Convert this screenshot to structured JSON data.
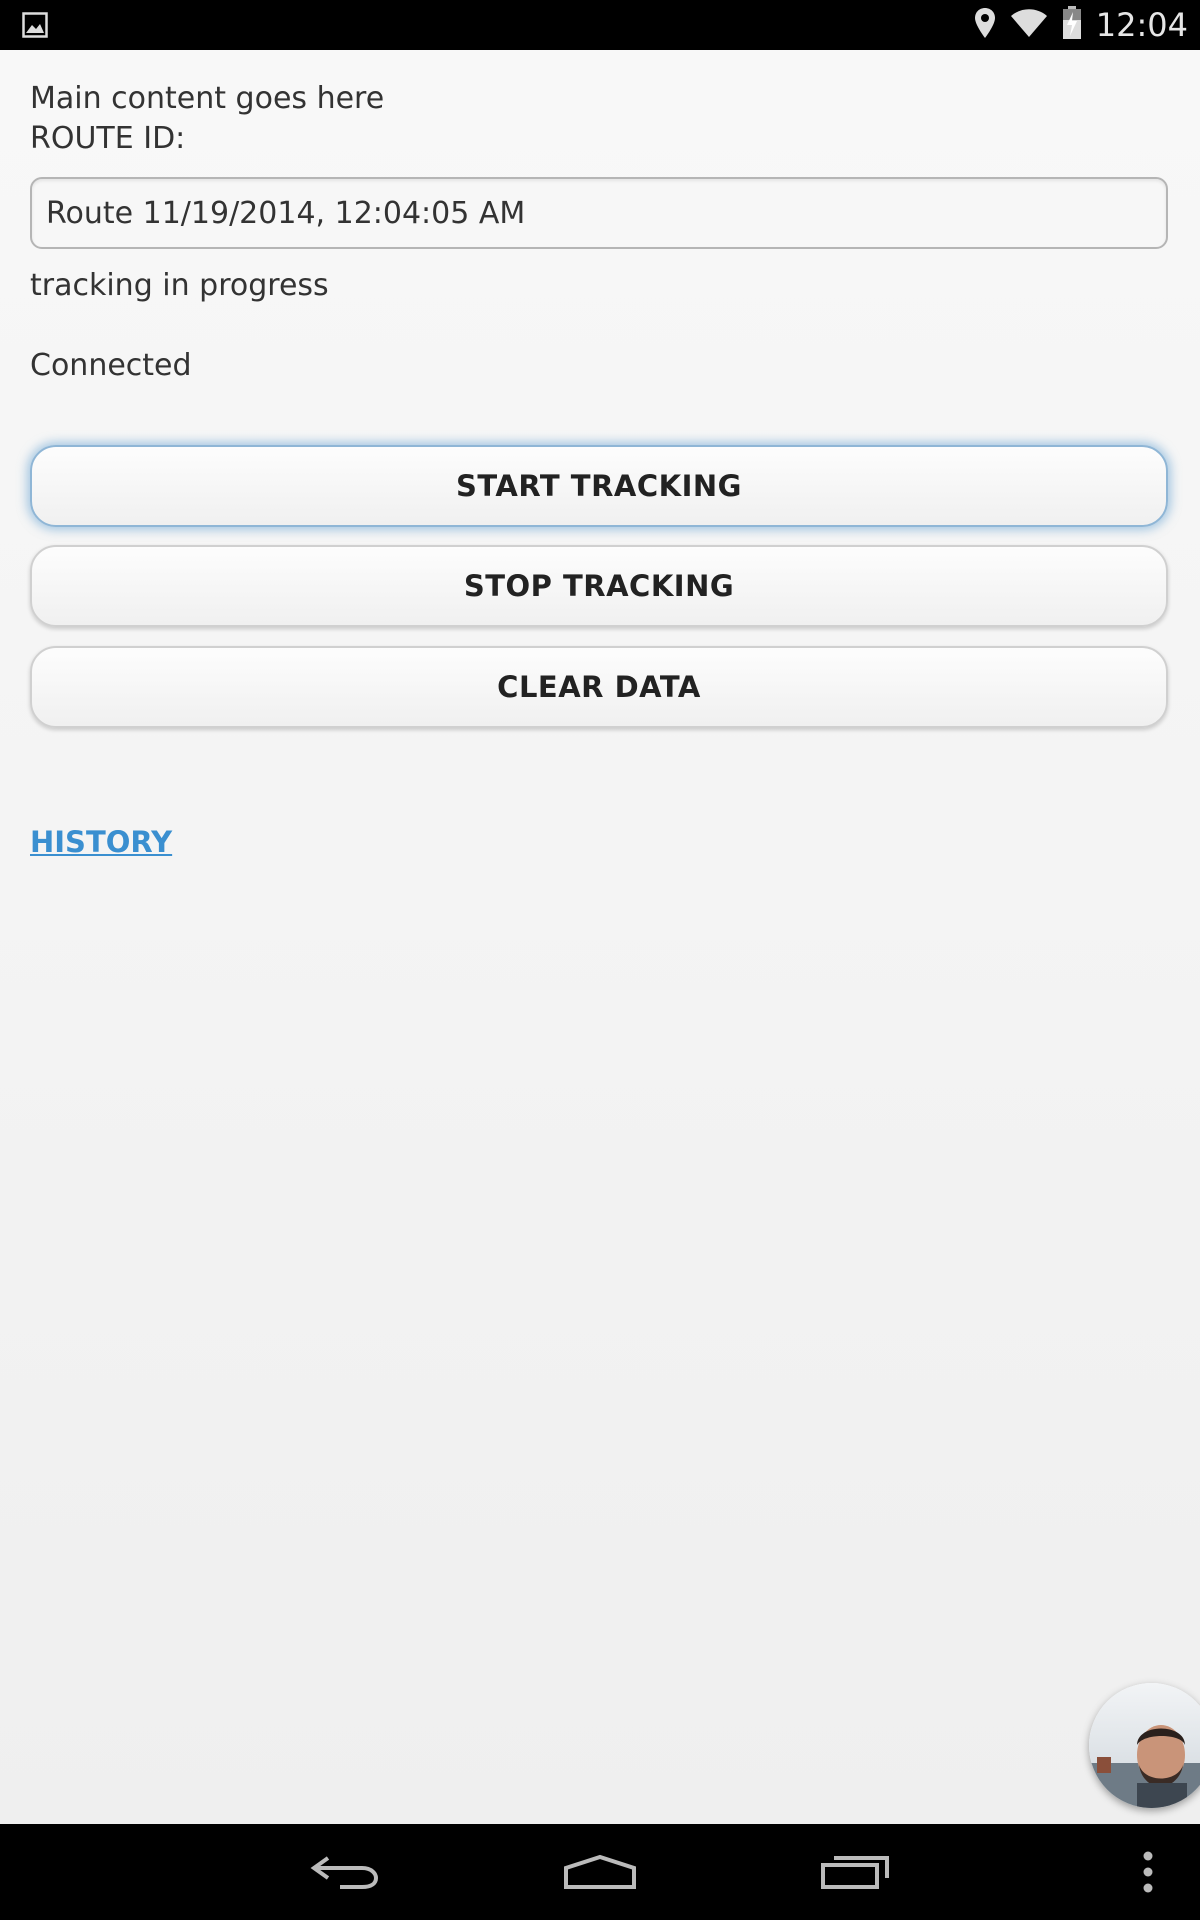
{
  "status_bar": {
    "left_icon": "image-notification-icon",
    "icons": [
      "location-icon",
      "wifi-icon",
      "battery-charging-icon"
    ],
    "time": "12:04"
  },
  "main": {
    "intro_text": "Main content goes here",
    "route_label": "ROUTE ID:",
    "route_value": "Route 11/19/2014, 12:04:05 AM",
    "tracking_status": "tracking in progress",
    "connection_status": "Connected",
    "buttons": {
      "start": "START TRACKING",
      "stop": "STOP TRACKING",
      "clear": "CLEAR DATA"
    },
    "history_link": "HISTORY"
  },
  "chat_head": {
    "icon": "profile-avatar"
  },
  "nav_bar": {
    "icons": [
      "back-icon",
      "home-icon",
      "recent-apps-icon",
      "overflow-menu-icon"
    ]
  },
  "colors": {
    "link": "#3a8fd0",
    "focus_glow": "#8fb6d6",
    "background": "#f4f4f4",
    "bars": "#000000"
  }
}
